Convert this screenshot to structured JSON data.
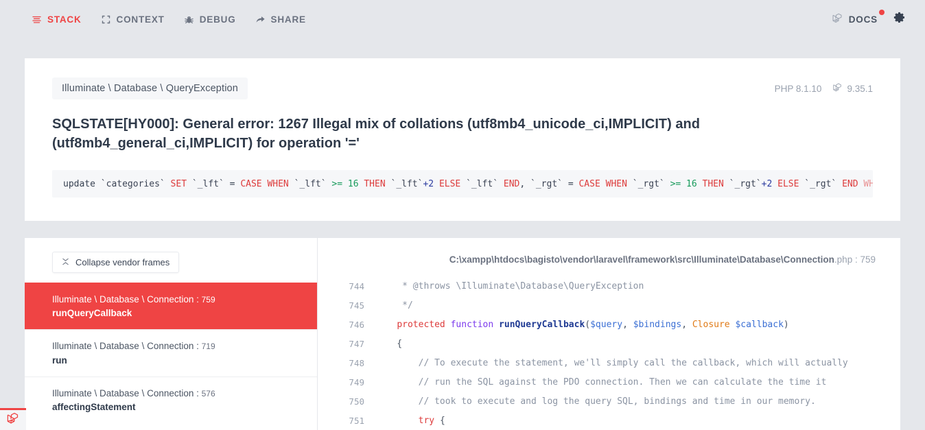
{
  "topbar": {
    "left_items": [
      {
        "label": "STACK",
        "icon": "stack-lines-icon",
        "active": true
      },
      {
        "label": "CONTEXT",
        "icon": "expand-brackets-icon",
        "active": false
      },
      {
        "label": "DEBUG",
        "icon": "bug-icon",
        "active": false
      },
      {
        "label": "SHARE",
        "icon": "share-arrow-icon",
        "active": false
      }
    ],
    "docs": {
      "label": "DOCS",
      "icon": "laravel-logo-icon",
      "has_notification_dot": true
    },
    "settings_icon": "gear-icon"
  },
  "exception": {
    "class": "Illuminate \\ Database \\ QueryException",
    "php_version": "PHP 8.1.10",
    "laravel_version": "9.35.1",
    "message": "SQLSTATE[HY000]: General error: 1267 Illegal mix of collations (utf8mb4_unicode_ci,IMPLICIT) and (utf8mb4_general_ci,IMPLICIT) for operation '='",
    "sql_tokens": [
      {
        "t": "update ",
        "c": "plain"
      },
      {
        "t": "`categories` ",
        "c": "id"
      },
      {
        "t": "SET ",
        "c": "kw"
      },
      {
        "t": "`_lft` ",
        "c": "id"
      },
      {
        "t": "= ",
        "c": "plain"
      },
      {
        "t": "CASE ",
        "c": "kw"
      },
      {
        "t": "WHEN ",
        "c": "kw"
      },
      {
        "t": "`_lft` ",
        "c": "id"
      },
      {
        "t": ">= ",
        "c": "op"
      },
      {
        "t": "16 ",
        "c": "num"
      },
      {
        "t": "THEN ",
        "c": "kw"
      },
      {
        "t": "`_lft`",
        "c": "id"
      },
      {
        "t": "+2 ",
        "c": "plus"
      },
      {
        "t": "ELSE ",
        "c": "kw"
      },
      {
        "t": "`_lft` ",
        "c": "id"
      },
      {
        "t": "END",
        "c": "kw"
      },
      {
        "t": ", ",
        "c": "plain"
      },
      {
        "t": "`_rgt` ",
        "c": "id"
      },
      {
        "t": "= ",
        "c": "plain"
      },
      {
        "t": "CASE ",
        "c": "kw"
      },
      {
        "t": "WHEN ",
        "c": "kw"
      },
      {
        "t": "`_rgt` ",
        "c": "id"
      },
      {
        "t": ">= ",
        "c": "op"
      },
      {
        "t": "16 ",
        "c": "num"
      },
      {
        "t": "THEN ",
        "c": "kw"
      },
      {
        "t": "`_rgt`",
        "c": "id"
      },
      {
        "t": "+2 ",
        "c": "plus"
      },
      {
        "t": "ELSE ",
        "c": "kw"
      },
      {
        "t": "`_rgt` ",
        "c": "id"
      },
      {
        "t": "END ",
        "c": "kw"
      },
      {
        "t": "WHE",
        "c": "kwfade"
      }
    ]
  },
  "frames_panel": {
    "collapse_label": "Collapse vendor frames",
    "collapse_icon": "collapse-icon",
    "frames": [
      {
        "class": "Illuminate \\ Database \\ Connection",
        "line": "759",
        "method": "runQueryCallback",
        "active": true
      },
      {
        "class": "Illuminate \\ Database \\ Connection",
        "line": "719",
        "method": "run",
        "active": false
      },
      {
        "class": "Illuminate \\ Database \\ Connection",
        "line": "576",
        "method": "affectingStatement",
        "active": false
      }
    ]
  },
  "code_panel": {
    "file_path": "C:\\xampp\\htdocs\\bagisto\\vendor\\laravel\\framework\\src\\Illuminate\\Database\\Connection",
    "file_ext": ".php",
    "file_line": "759",
    "lines": [
      {
        "no": "744",
        "tokens": [
          {
            "t": "     * @throws \\Illuminate\\Database\\QueryException",
            "c": "com"
          }
        ]
      },
      {
        "no": "745",
        "tokens": [
          {
            "t": "     */",
            "c": "com"
          }
        ]
      },
      {
        "no": "746",
        "tokens": [
          {
            "t": "    ",
            "c": "pun"
          },
          {
            "t": "protected ",
            "c": "kw"
          },
          {
            "t": "function ",
            "c": "fn"
          },
          {
            "t": "runQueryCallback",
            "c": "name"
          },
          {
            "t": "(",
            "c": "pun"
          },
          {
            "t": "$query",
            "c": "var"
          },
          {
            "t": ", ",
            "c": "pun"
          },
          {
            "t": "$bindings",
            "c": "var"
          },
          {
            "t": ", ",
            "c": "pun"
          },
          {
            "t": "Closure ",
            "c": "type"
          },
          {
            "t": "$callback",
            "c": "var"
          },
          {
            "t": ")",
            "c": "pun"
          }
        ]
      },
      {
        "no": "747",
        "tokens": [
          {
            "t": "    {",
            "c": "pun"
          }
        ]
      },
      {
        "no": "748",
        "tokens": [
          {
            "t": "        // To execute the statement, we'll simply call the callback, which will actually",
            "c": "com"
          }
        ]
      },
      {
        "no": "749",
        "tokens": [
          {
            "t": "        // run the SQL against the PDO connection. Then we can calculate the time it",
            "c": "com"
          }
        ]
      },
      {
        "no": "750",
        "tokens": [
          {
            "t": "        // took to execute and log the query SQL, bindings and time in our memory.",
            "c": "com"
          }
        ]
      },
      {
        "no": "751",
        "tokens": [
          {
            "t": "        ",
            "c": "pun"
          },
          {
            "t": "try ",
            "c": "kw"
          },
          {
            "t": "{",
            "c": "pun"
          }
        ]
      }
    ]
  },
  "flare_badge": {
    "icon": "laravel-logo-icon"
  },
  "colors": {
    "accent_red": "#ef4444",
    "background": "#e5e7eb",
    "card": "#ffffff",
    "muted_text": "#6b7280",
    "heading_text": "#2f3a4a"
  }
}
